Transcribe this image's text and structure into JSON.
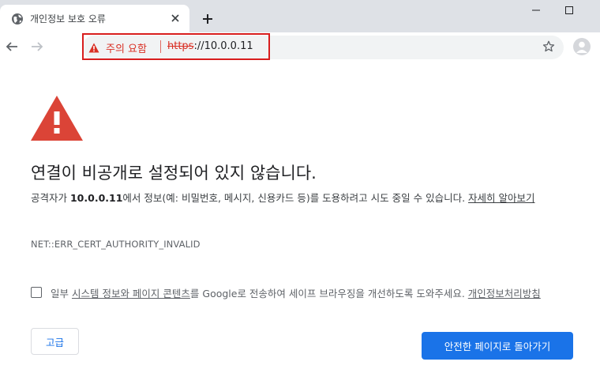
{
  "tab": {
    "title": "개인정보 보호 오류",
    "favicon": "globe-icon"
  },
  "addressbar": {
    "security_label": "주의 요함",
    "url_scheme": "https",
    "url_rest": "://10.0.0.11"
  },
  "page": {
    "heading": "연결이 비공개로 설정되어 있지 않습니다.",
    "desc_before": "공격자가 ",
    "desc_host": "10.0.0.11",
    "desc_after": "에서 정보(예: 비밀번호, 메시지, 신용카드 등)를 도용하려고 시도 중일 수 있습니다. ",
    "desc_link": "자세히 알아보기",
    "error_code": "NET::ERR_CERT_AUTHORITY_INVALID",
    "optin_before": "일부 ",
    "optin_link1": "시스템 정보와 페이지 콘텐츠",
    "optin_mid": "를 Google로 전송하여 세이프 브라우징을 개선하도록 도와주세요. ",
    "optin_link2": "개인정보처리방침",
    "advanced_button": "고급",
    "back_button": "안전한 페이지로 돌아가기"
  },
  "colors": {
    "warning_red": "#d93025",
    "highlight_box": "#d81e1e",
    "primary_blue": "#1a73e8",
    "tabstrip_gray": "#dee1e6"
  }
}
